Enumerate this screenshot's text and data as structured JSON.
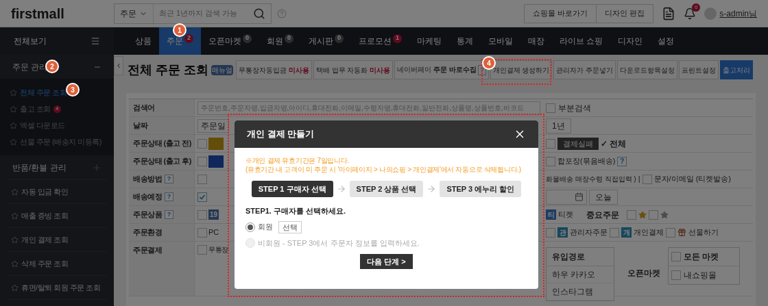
{
  "header": {
    "logo": "firstmall",
    "search": {
      "scope": "주문",
      "placeholder": "최근 1년까지 검색 가능"
    },
    "buttons": [
      "쇼핑몰 바로가기",
      "디자인 편집"
    ],
    "notification_count": "0",
    "user": "s-admin님"
  },
  "nav": {
    "all_menu": "전체보기",
    "tabs": [
      {
        "label": "상품",
        "selected": false
      },
      {
        "label": "주문",
        "badge": "2",
        "selected": true
      },
      {
        "label": "오픈마켓",
        "badge": "0",
        "selected": false
      },
      {
        "label": "회원",
        "badge": "0",
        "selected": false
      },
      {
        "label": "게시판",
        "badge": "0",
        "selected": false
      },
      {
        "label": "프로모션",
        "badge": "1",
        "selected": false
      },
      {
        "label": "마케팅",
        "selected": false
      },
      {
        "label": "통계",
        "selected": false
      },
      {
        "label": "모바일",
        "selected": false
      },
      {
        "label": "매장",
        "selected": false
      },
      {
        "label": "라이브 쇼핑",
        "selected": false
      },
      {
        "label": "디자인",
        "selected": false
      },
      {
        "label": "설정",
        "selected": false
      }
    ]
  },
  "sidebar": [
    {
      "kind": "group",
      "title": "주문 관리",
      "expanded": true,
      "items": [
        {
          "label": "전체 주문 조회",
          "selected": true
        },
        {
          "label": "출고 조회",
          "badge": "4",
          "selected": false
        },
        {
          "label": "엑셀 다운로드",
          "selected": false
        },
        {
          "label": "선물 주문 (배송지 미등록)",
          "selected": false
        }
      ]
    },
    {
      "kind": "group",
      "title": "반품/환불 관리",
      "expanded": false
    },
    {
      "kind": "link",
      "title": "자동 입금 확인"
    },
    {
      "kind": "link",
      "title": "매출 증빙 조회"
    },
    {
      "kind": "link",
      "title": "개인 결제 조회"
    },
    {
      "kind": "link",
      "title": "삭제 주문 조회"
    },
    {
      "kind": "link",
      "title": "휴면/탈퇴 회원 주문 조회"
    }
  ],
  "toolbar": {
    "title": "전체 주문 조회",
    "manual": "매뉴얼",
    "buttons": [
      {
        "kind": "status",
        "label": "무통장자동입금",
        "status": "미사용"
      },
      {
        "kind": "status",
        "label": "택배 업무 자동화",
        "status": "미사용"
      },
      {
        "kind": "naverpay",
        "label": "네이버페이",
        "status": "주문 바로수집",
        "help": "?"
      },
      {
        "kind": "plain",
        "label": "개인결제 생성하기"
      },
      {
        "kind": "plain",
        "label": "관리자가 주문넣기"
      },
      {
        "kind": "plain",
        "label": "다운로드항목설정"
      },
      {
        "kind": "plain",
        "label": "프린트설정"
      },
      {
        "kind": "primary",
        "label": "출고처리"
      }
    ]
  },
  "form": {
    "rows": [
      {
        "kind": "search",
        "label": "검색어",
        "placeholder": "주문번호,주문자명,입금자명,아이디,휴대전화,이메일,수령자명,휴대전화,일반전화,상품명,상품번호,바코드",
        "left": [],
        "right": [
          {
            "kind": "checkbox",
            "label": "부분검색",
            "checked": false
          }
        ]
      },
      {
        "kind": "plain",
        "label": "날짜",
        "left": [
          {
            "kind": "select",
            "value": "주문일"
          }
        ],
        "right": [
          {
            "kind": "button",
            "label": "1년"
          }
        ]
      },
      {
        "kind": "plain",
        "label": "주문상태 (출고 전)",
        "left": [
          {
            "kind": "checkbox",
            "checked": false
          },
          {
            "kind": "chip_gold"
          }
        ],
        "right": [
          {
            "kind": "checkbox",
            "checked": false
          },
          {
            "kind": "chip_dark",
            "label": "결제실패"
          },
          {
            "kind": "strong",
            "label": "✓ 전체"
          }
        ]
      },
      {
        "kind": "plain",
        "label": "주문상태 (출고 후)",
        "left": [
          {
            "kind": "checkbox",
            "checked": false
          },
          {
            "kind": "chip_blue"
          }
        ],
        "right": [
          {
            "kind": "checkbox",
            "checked": false
          },
          {
            "kind": "text",
            "label": "합포장(묶음배송)"
          },
          {
            "kind": "help",
            "label": "?"
          }
        ]
      },
      {
        "kind": "plain",
        "label": "배송방법",
        "help": "?",
        "left": [
          {
            "kind": "checkbox",
            "checked": false
          }
        ],
        "right": [
          {
            "kind": "note",
            "label": "화물배송 매장수령 직접입력 )"
          },
          {
            "kind": "text",
            "label": "|"
          },
          {
            "kind": "checkbox",
            "checked": false
          },
          {
            "kind": "text",
            "label": "문자/이메일 (티켓발송)"
          }
        ]
      },
      {
        "kind": "plain",
        "label": "배송예정",
        "help": "?",
        "left": [
          {
            "kind": "checkbox",
            "checked": true
          }
        ],
        "right": [
          {
            "kind": "date"
          },
          {
            "kind": "button",
            "label": "오늘"
          }
        ]
      },
      {
        "kind": "plain",
        "label": "주문상품",
        "help": "?",
        "left": [
          {
            "kind": "checkbox",
            "checked": false
          },
          {
            "kind": "tag_slate",
            "label": "19"
          }
        ],
        "right": [
          {
            "kind": "tag_blue",
            "label": "티"
          },
          {
            "kind": "text",
            "label": "티켓"
          },
          {
            "kind": "label",
            "label": "중요주문"
          },
          {
            "kind": "checkbox",
            "checked": false
          },
          {
            "kind": "star_gold"
          },
          {
            "kind": "checkbox",
            "checked": false
          },
          {
            "kind": "star_gray"
          }
        ]
      },
      {
        "kind": "plain",
        "label": "주문환경",
        "left": [
          {
            "kind": "checkbox",
            "checked": false
          },
          {
            "kind": "text",
            "label": "PC"
          }
        ],
        "right": [
          {
            "kind": "checkbox",
            "checked": false
          },
          {
            "kind": "tag_teal",
            "label": "관"
          },
          {
            "kind": "text",
            "label": "관리자주문"
          },
          {
            "kind": "checkbox",
            "checked": false
          },
          {
            "kind": "tag_teal",
            "label": "개"
          },
          {
            "kind": "text",
            "label": "개인결제"
          },
          {
            "kind": "checkbox",
            "checked": false
          },
          {
            "kind": "gift"
          },
          {
            "kind": "text",
            "label": "선물하기"
          }
        ]
      },
      {
        "kind": "tall",
        "label": "주문결제",
        "left": [
          {
            "kind": "checkbox",
            "checked": false
          },
          {
            "kind": "small",
            "label": "무통장"
          }
        ],
        "right": [
          {
            "kind": "listbox",
            "header": "유입경로",
            "items": [
              "하우 카카오",
              "인스타그램"
            ]
          },
          {
            "kind": "label",
            "label": "오픈마켓"
          },
          {
            "kind": "checklist",
            "items": [
              {
                "label": "모든 마켓",
                "checked": false
              },
              {
                "label": "내쇼핑몰",
                "checked": false
              }
            ]
          }
        ]
      }
    ]
  },
  "modal": {
    "title": "개인 결제 만들기",
    "notice": [
      "※개인 결제 유효기간은 7일입니다.",
      "(유효기간 내 고객이 미 주문 시 '마이페이지 > 나의쇼핑 > 개인결제'에서 자동으로 삭제됩니다.)"
    ],
    "steps": [
      {
        "label": "STEP 1 구매자 선택",
        "selected": true
      },
      {
        "label": "STEP 2 상품 선택",
        "selected": false
      },
      {
        "label": "STEP 3 에누리 할인",
        "selected": false
      }
    ],
    "heading": "STEP1. 구매자를 선택하세요.",
    "options": [
      {
        "label": "회원",
        "selected": true,
        "disabled": false,
        "button": "선택"
      },
      {
        "label": "비회원 - STEP 3에서 주문자 정보를 입력하세요.",
        "selected": false,
        "disabled": true
      }
    ],
    "next": "다음 단계 >"
  },
  "annotations": [
    "1",
    "2",
    "3",
    "4"
  ]
}
